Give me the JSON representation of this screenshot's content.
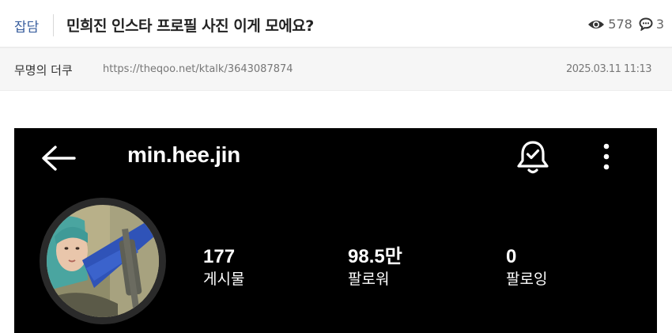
{
  "post": {
    "category": "잡담",
    "title": "민희진 인스타 프로필 사진 이게 모에요?",
    "views": "578",
    "comments": "3",
    "author": "무명의 더쿠",
    "url": "https://theqoo.net/ktalk/3643087874",
    "date": "2025.03.11 11:13"
  },
  "icons": {
    "views": "eye-icon",
    "comments": "comment-icon",
    "back": "arrow-left-icon",
    "notifications": "bell-check-icon",
    "more": "more-vertical-icon"
  },
  "instagram": {
    "username": "min.hee.jin",
    "stats": {
      "posts_value": "177",
      "posts_label": "게시물",
      "followers_value": "98.5만",
      "followers_label": "팔로워",
      "following_value": "0",
      "following_label": "팔로잉"
    }
  },
  "colors": {
    "category": "#3a5f9f",
    "embed_background": "#000000",
    "meta_background": "#f6f6f6"
  }
}
